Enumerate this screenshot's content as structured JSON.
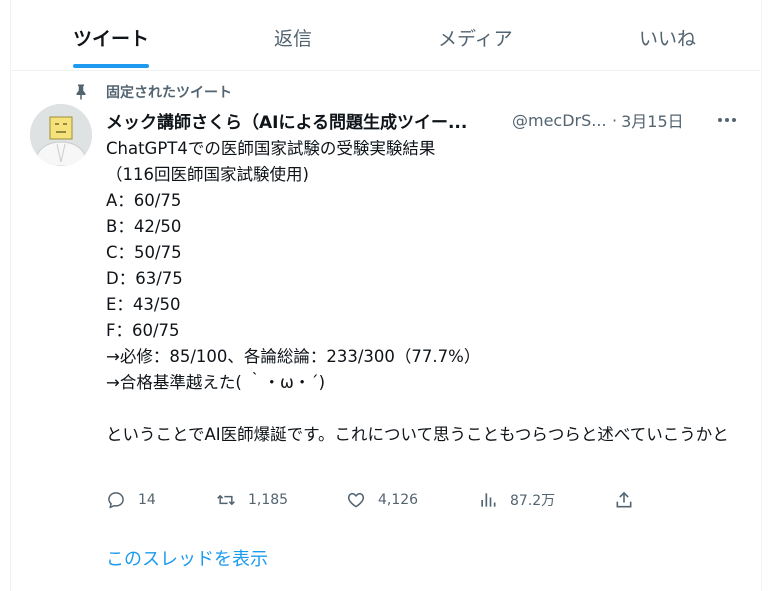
{
  "tabs": [
    {
      "label": "ツイート",
      "active": true
    },
    {
      "label": "返信",
      "active": false
    },
    {
      "label": "メディア",
      "active": false
    },
    {
      "label": "いいね",
      "active": false
    }
  ],
  "tweet": {
    "pinned_label": "固定されたツイート",
    "display_name": "メック講師さくら（AIによる問題生成ツイー...",
    "handle": "@mecDrS...",
    "separator": "·",
    "date": "3月15日",
    "lines": [
      "ChatGPT4での医師国家試験の受験実験結果",
      "（116回医師国家試験使用)",
      "A：60/75",
      "B：42/50",
      "C：50/75",
      "D：63/75",
      "E：43/50",
      "F：60/75",
      "→必修：85/100、各論総論：233/300（77.7%）",
      "→合格基準越えた( ｀・ω・´)"
    ],
    "closing": "ということでAI医師爆誕です。これについて思うこともつらつらと述べていこうかと",
    "replies": "14",
    "retweets": "1,185",
    "likes": "4,126",
    "views": "87.2万",
    "thread_link": "このスレッドを表示"
  },
  "colors": {
    "accent": "#1d9bf0",
    "text": "#0f1419",
    "muted": "#536471",
    "border": "#eff3f4"
  },
  "icons": [
    "pin-icon",
    "more-icon",
    "reply-icon",
    "retweet-icon",
    "like-icon",
    "views-icon",
    "share-icon"
  ]
}
